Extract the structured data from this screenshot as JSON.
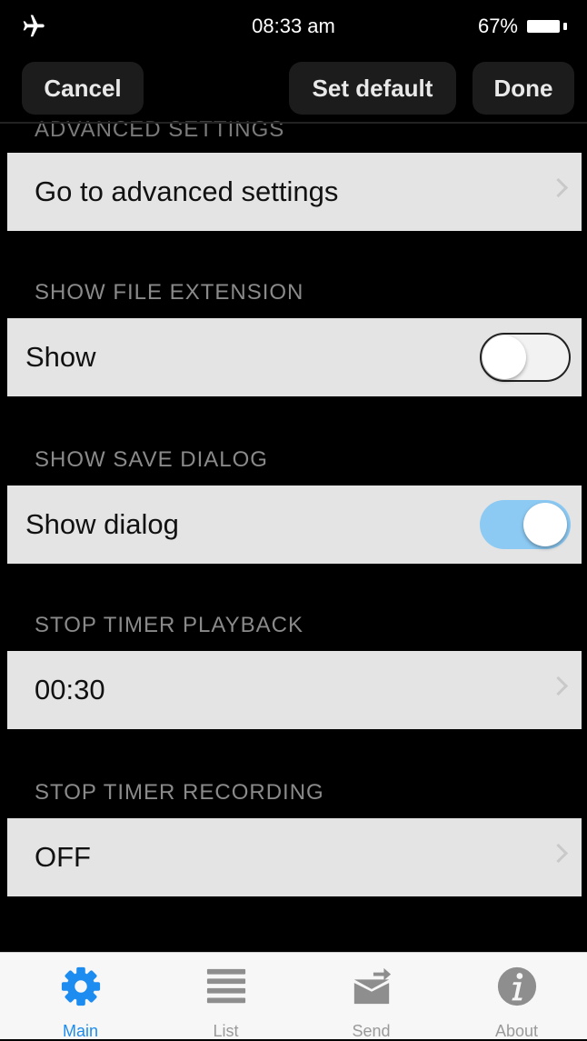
{
  "status_bar": {
    "time": "08:33 am",
    "battery": "67%"
  },
  "nav": {
    "cancel": "Cancel",
    "set_default": "Set default",
    "done": "Done"
  },
  "sections": {
    "advanced": {
      "header": "ADVANCED SETTINGS",
      "row_label": "Go to advanced settings"
    },
    "file_ext": {
      "header": "SHOW FILE EXTENSION",
      "row_label": "Show",
      "toggle_on": false
    },
    "save_dialog": {
      "header": "SHOW SAVE DIALOG",
      "row_label": "Show dialog",
      "toggle_on": true
    },
    "timer_playback": {
      "header": "STOP TIMER PLAYBACK",
      "row_value": "00:30"
    },
    "timer_recording": {
      "header": "STOP TIMER RECORDING",
      "row_value": "OFF"
    }
  },
  "tabs": [
    {
      "label": "Main",
      "icon": "gear-icon",
      "active": true
    },
    {
      "label": "List",
      "icon": "list-icon",
      "active": false
    },
    {
      "label": "Send",
      "icon": "send-icon",
      "active": false
    },
    {
      "label": "About",
      "icon": "info-icon",
      "active": false
    }
  ],
  "colors": {
    "accent": "#1d8cf0",
    "toggle_on": "#8ccaf4"
  }
}
